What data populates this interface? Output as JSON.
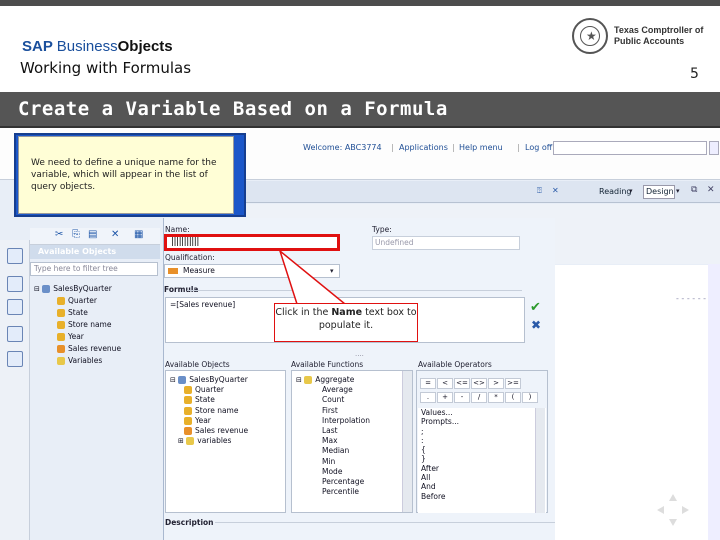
{
  "header": {
    "logo_sap": "SAP",
    "logo_business": "Business",
    "logo_objects": "Objects",
    "subtitle": "Working with Formulas",
    "page_number": "5",
    "comptroller_line1": "Texas Comptroller of",
    "comptroller_line2": "Public Accounts",
    "slide_title": "Create a Variable Based on a Formula"
  },
  "app": {
    "welcome": "Welcome: ABC3774",
    "applications": "Applications",
    "help_menu": "Help menu",
    "log_off": "Log off",
    "reading": "Reading",
    "design": "Design",
    "available_objects_header": "Available Objects",
    "filter_placeholder": "Type here to filter tree",
    "tree": [
      "SalesByQuarter",
      "Quarter",
      "State",
      "Store name",
      "Year",
      "Sales revenue",
      "Variables"
    ]
  },
  "dialog": {
    "name_label": "Name:",
    "name_value": "|||||||||||",
    "type_label": "Type:",
    "type_value": "Undefined",
    "qualification_label": "Qualification:",
    "qualification_value": "Measure",
    "formula_label": "Formula",
    "formula_value": "=[Sales revenue]",
    "available_objects_label": "Available Objects",
    "objects": [
      "SalesByQuarter",
      "Quarter",
      "State",
      "Store name",
      "Year",
      "Sales revenue",
      "variables"
    ],
    "available_functions_label": "Available Functions",
    "functions": [
      "Aggregate",
      "Average",
      "Count",
      "First",
      "Interpolation",
      "Last",
      "Max",
      "Median",
      "Min",
      "Mode",
      "Percentage",
      "Percentile"
    ],
    "available_operators_label": "Available Operators",
    "operators_row1": [
      "=",
      "<",
      "<=",
      "<>",
      ">",
      ">="
    ],
    "operators_row2": [
      ".",
      "+",
      "-",
      "/",
      "*",
      "(",
      ")"
    ],
    "operators_list": [
      "Values...",
      "Prompts...",
      ";",
      ":",
      "{",
      "}",
      "After",
      "All",
      "And",
      "Before"
    ],
    "description_label": "Description"
  },
  "tooltip": {
    "text": "We need to define a unique name for the variable, which will appear in the list of query objects."
  },
  "callout": {
    "prefix": "Click in the ",
    "bold": "Name",
    "suffix": " text box to populate it."
  },
  "colors": {
    "title_bar": "#555555",
    "tooltip_border": "#1b57c9",
    "highlight": "#e01010"
  }
}
